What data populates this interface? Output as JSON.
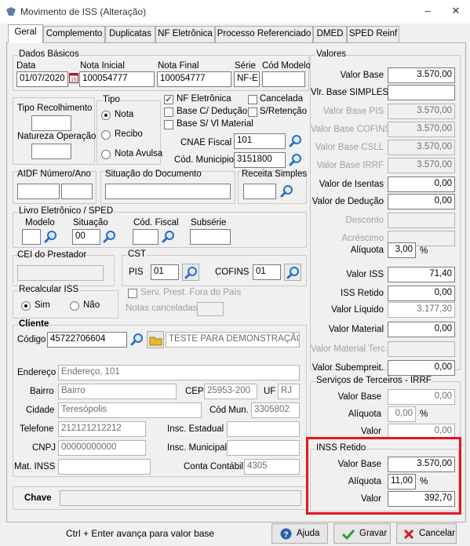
{
  "window": {
    "title": "Movimento de ISS (Alteração)",
    "minimize": "–",
    "close": "✕"
  },
  "tabs": [
    "Geral",
    "Complemento",
    "Duplicatas",
    "NF Eletrônica",
    "Processo Referenciado",
    "DMED",
    "SPED Reinf"
  ],
  "dados_basicos": {
    "legend": "Dados Básicos",
    "data_label": "Data",
    "data_value": "01/07/2020",
    "nota_inicial_label": "Nota Inicial",
    "nota_inicial_value": "100054777",
    "nota_final_label": "Nota Final",
    "nota_final_value": "100054777",
    "serie_label": "Série",
    "serie_value": "NF-E",
    "cod_modelo_label": "Cód Modelo",
    "cod_modelo_value": ""
  },
  "tipo_recolhimento_label": "Tipo Recolhimento",
  "natureza_operacao_label": "Natureza Operação",
  "tipo": {
    "legend": "Tipo",
    "options": [
      "Nota",
      "Recibo",
      "Nota Avulsa"
    ],
    "selected": "Nota"
  },
  "checks": {
    "nf_eletronica": "NF Eletrônica",
    "cancelada": "Cancelada",
    "base_c_deducao": "Base C/ Dedução",
    "s_retencao": "S/Retenção",
    "base_s_vl_material": "Base S/ Vl Material"
  },
  "cnae_fiscal": {
    "label": "CNAE Fiscal",
    "value": "101"
  },
  "cod_municipio": {
    "label": "Cód. Municipio",
    "value": "3151800"
  },
  "aidf": {
    "label": "AIDF Número/Ano"
  },
  "situacao_documento": {
    "label": "Situação do Documento"
  },
  "receita_simples": {
    "label": "Receita Simples"
  },
  "livro": {
    "legend": "Livro Eletrônico / SPED",
    "modelo_label": "Modelo",
    "situacao_label": "Situação",
    "situacao_value": "00",
    "cod_fiscal_label": "Cód. Fiscal",
    "subserie_label": "Subsérie"
  },
  "cei_label": "CEI do Prestador",
  "cst": {
    "legend": "CST",
    "pis_label": "PIS",
    "pis_value": "01",
    "cofins_label": "COFINS",
    "cofins_value": "01"
  },
  "recalcular": {
    "legend": "Recalcular ISS",
    "sim": "Sim",
    "nao": "Não",
    "selected": "Sim"
  },
  "serv_prest": "Serv. Prest. Fora do País",
  "notas_canceladas": "Notas canceladas",
  "cliente": {
    "legend": "Cliente",
    "codigo_label": "Código",
    "codigo_value": "45722706604",
    "nome_value": "TESTE PARA DEMONSTRAÇÃO",
    "endereco_label": "Endereço",
    "endereco_value": "Endereço, 101",
    "bairro_label": "Bairro",
    "bairro_value": "Bairro",
    "cep_label": "CEP",
    "cep_value": "25953-200",
    "uf_label": "UF",
    "uf_value": "RJ",
    "cidade_label": "Cidade",
    "cidade_value": "Teresópolis",
    "cod_mun_label": "Cód Mun.",
    "cod_mun_value": "3305802",
    "telefone_label": "Telefone",
    "telefone_value": "212121212212",
    "insc_estadual_label": "Insc. Estadual",
    "cnpj_label": "CNPJ",
    "cnpj_value": "00000000000",
    "insc_municipal_label": "Insc. Municipal",
    "mat_inss_label": "Mat. INSS",
    "conta_contabil_label": "Conta Contábil",
    "conta_contabil_value": "4305"
  },
  "chave_label": "Chave",
  "valores": {
    "legend": "Valores",
    "rows": [
      {
        "label": "Valor Base",
        "value": "3.570,00",
        "enabled": true
      },
      {
        "label": "Vlr. Base SIMPLES",
        "value": "",
        "enabled": true
      },
      {
        "label": "Valor Base PIS",
        "value": "3.570,00",
        "enabled": false
      },
      {
        "label": "Valor Base COFINS",
        "value": "3.570,00",
        "enabled": false
      },
      {
        "label": "Valor Base CSLL",
        "value": "3.570,00",
        "enabled": false
      },
      {
        "label": "Valor Base IRRF",
        "value": "3.570,00",
        "enabled": false
      },
      {
        "label": "Valor de Isentas",
        "value": "0,00",
        "enabled": true
      },
      {
        "label": "Valor de Dedução",
        "value": "0,00",
        "enabled": true
      },
      {
        "label": "Desconto",
        "value": "",
        "enabled": false
      },
      {
        "label": "Acréscimo",
        "value": "",
        "enabled": false
      }
    ],
    "aliquota_label": "Alíquota",
    "aliquota_value": "3,00",
    "pct": "%",
    "rows2": [
      {
        "label": "Valor ISS",
        "value": "71,40",
        "enabled": true
      },
      {
        "label": "ISS Retido",
        "value": "0,00",
        "enabled": true
      },
      {
        "label": "Valor Líquido",
        "value": "3.177,30",
        "enabled": true,
        "readonly": true
      },
      {
        "label": "Valor Material",
        "value": "0,00",
        "enabled": true
      },
      {
        "label": "Valor Material Terc.",
        "value": "",
        "enabled": false
      },
      {
        "label": "Valor Subempreit.",
        "value": "0,00",
        "enabled": true
      }
    ]
  },
  "irrf": {
    "legend": "Serviços de Terceiros - IRRF",
    "valor_base_label": "Valor Base",
    "valor_base_value": "0,00",
    "aliquota_label": "Alíquota",
    "aliquota_value": "0,00",
    "pct": "%",
    "valor_label": "Valor",
    "valor_value": "0,00"
  },
  "inss": {
    "legend": "INSS Retido",
    "valor_base_label": "Valor Base",
    "valor_base_value": "3.570,00",
    "aliquota_label": "Alíquota",
    "aliquota_value": "11,00",
    "pct": "%",
    "valor_label": "Valor",
    "valor_value": "392,70"
  },
  "status_text": "Ctrl + Enter avança para valor base",
  "buttons": {
    "ajuda": "Ajuda",
    "gravar": "Gravar",
    "cancelar": "Cancelar"
  },
  "colors": {
    "highlight": "#e3171e",
    "magnifier": "#2a6fbf",
    "folder": "#e8b92a"
  }
}
